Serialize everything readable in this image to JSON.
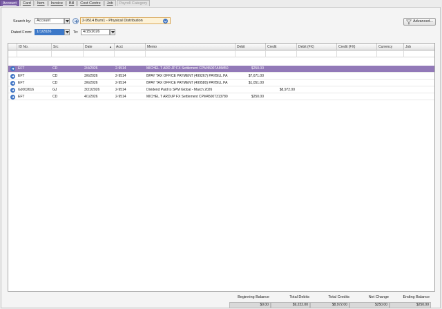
{
  "tabs": [
    {
      "label": "Account",
      "active": true
    },
    {
      "label": "Card"
    },
    {
      "label": "Item"
    },
    {
      "label": "Invoice"
    },
    {
      "label": "Bill"
    },
    {
      "label": "Cost Centre"
    },
    {
      "label": "Job"
    },
    {
      "label": "Payroll Category",
      "disabled": true
    }
  ],
  "filters": {
    "search_by_label": "Search by:",
    "search_by_value": "Account",
    "account_value": "2-9514 Burn1 - Physical Distribution",
    "dated_from_label": "Dated From:",
    "dated_from_value": "1/1/2026",
    "to_label": "To:",
    "to_value": "4/15/2026",
    "advanced_label": "Advanced..."
  },
  "grid": {
    "columns": [
      "ID No.",
      "Src",
      "Date",
      "Acct",
      "Memo",
      "Debit",
      "Credit",
      "Debit (FX)",
      "Credit (FX)",
      "Currency",
      "Job"
    ],
    "sort_indicator": "▲",
    "rows": [
      {
        "id": "EFT",
        "src": "CD",
        "date": "2/4/2026",
        "acct": "2-9514",
        "memo": "MICHEL T ARD JP FX Settlement CPM45007AMM50",
        "debit": "$250.00",
        "credit": "",
        "selected": true
      },
      {
        "id": "EFT",
        "src": "CD",
        "date": "3/6/2026",
        "acct": "2-9514",
        "memo": "BPAY TAX OFFICE PAYMENT (499267) PAYBILL PA",
        "debit": "$7,671.00",
        "credit": ""
      },
      {
        "id": "EFT",
        "src": "CD",
        "date": "3/6/2026",
        "acct": "2-9514",
        "memo": "BPAY TAX OFFICE PAYMENT (499580) PAYBILL PA",
        "debit": "$1,051.00",
        "credit": ""
      },
      {
        "id": "GJ002616",
        "src": "GJ",
        "date": "3/31/2026",
        "acct": "2-9514",
        "memo": "Dividend Paid to SPM Global - March 2026",
        "debit": "",
        "credit": "$8,972.00"
      },
      {
        "id": "EFT",
        "src": "CD",
        "date": "4/1/2026",
        "acct": "2-9514",
        "memo": "MICHEL T ARDUP FX Settlement CPM45007313780",
        "debit": "$250.00",
        "credit": ""
      }
    ]
  },
  "summary": [
    {
      "label": "Beginning Balance",
      "value": "$0.00"
    },
    {
      "label": "Total Debits",
      "value": "$9,222.00"
    },
    {
      "label": "Total Credits",
      "value": "$8,972.00"
    },
    {
      "label": "Net Change",
      "value": "$250.00"
    },
    {
      "label": "Ending Balance",
      "value": "$250.00"
    }
  ],
  "colors": {
    "active_tab": "#7b5ea7",
    "selected_row": "#9279b8",
    "row_icon": "#3f74c4",
    "date_highlight": "#3c78c8"
  },
  "icons": {
    "row_zoom": "arrow-right-circle-icon",
    "advanced": "advanced-filter-icon",
    "dropdown": "chevron-down-icon",
    "account_go": "arrow-circle-icon"
  }
}
